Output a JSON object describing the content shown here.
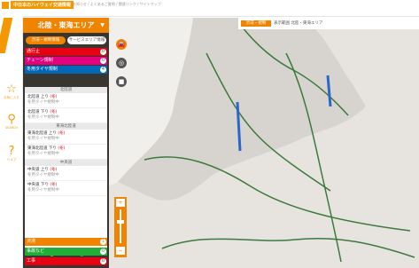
{
  "header": {
    "title": "中日本のハイウェイ交通情報",
    "subtitle": "お知らせ / よくあるご質問 / 関連リンク / サイトマップ"
  },
  "left_tools": [
    {
      "icon": "star-icon",
      "glyph": "☆",
      "label": "お気に入り"
    },
    {
      "icon": "search-icon",
      "glyph": "⚲",
      "label": "SEARCH"
    },
    {
      "icon": "help-icon",
      "glyph": "?",
      "label": "ヘルプ"
    }
  ],
  "panel": {
    "region": "北陸・東海エリア",
    "tabs": [
      "渋滞・規制情報",
      "サービスエリア情報"
    ],
    "categories": [
      {
        "label": "通行止",
        "color": "#e60012",
        "count": "0"
      },
      {
        "label": "チェーン規制",
        "color": "#e4007f",
        "count": "0"
      },
      {
        "label": "冬用タイヤ規制",
        "color": "#0068b7",
        "count": "4"
      }
    ],
    "list": {
      "sections": [
        {
          "header": "北陸道",
          "entries": [
            {
              "name": "北陸道 上り",
              "tag": "(冬)",
              "detail": "冬用タイヤ規制中"
            },
            {
              "name": "北陸道 下り",
              "tag": "(冬)",
              "detail": "冬用タイヤ規制中"
            }
          ]
        },
        {
          "header": "東海北陸道",
          "entries": [
            {
              "name": "東海北陸道 上り",
              "tag": "(冬)",
              "detail": "冬用タイヤ規制中"
            },
            {
              "name": "東海北陸道 下り",
              "tag": "(冬)",
              "detail": "冬用タイヤ規制中"
            }
          ]
        },
        {
          "header": "中央道",
          "entries": [
            {
              "name": "中央道 上り",
              "tag": "(冬)",
              "detail": "冬用タイヤ規制中"
            },
            {
              "name": "中央道 下り",
              "tag": "(冬)",
              "detail": "冬用タイヤ規制中"
            }
          ]
        }
      ]
    },
    "bottom_categories": [
      {
        "label": "渋滞",
        "color": "#f08300",
        "count": "1"
      },
      {
        "label": "事故など",
        "color": "#22ac38",
        "count": "0"
      },
      {
        "label": "工事",
        "color": "#e60012",
        "count": "0"
      }
    ],
    "footer_dot_colors": [
      "#f08300",
      "#22ac38"
    ]
  },
  "map": {
    "toolbar_tab": "渋滞・規制",
    "toolbar_text": "表示範囲 北陸・東海エリア",
    "controls": [
      {
        "icon": "car-icon",
        "glyph": "🚘",
        "color": "#f08300"
      },
      {
        "icon": "map-layer-icon",
        "glyph": "◎",
        "color": "#555555"
      },
      {
        "icon": "camera-icon",
        "glyph": "■",
        "color": "#555555"
      }
    ],
    "zoom": {
      "plus": "+",
      "minus": "−",
      "level": 0.35
    }
  }
}
